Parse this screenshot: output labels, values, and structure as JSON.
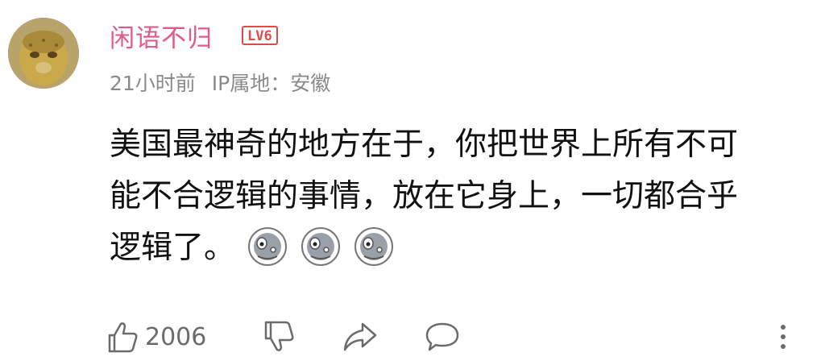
{
  "comment": {
    "username": "闲语不归",
    "level_badge": "LV6",
    "time": "21小时前",
    "ip_location": "IP属地：安徽",
    "text_lines": [
      "美国最神奇的地方在于，你把世界上所有不可",
      "能不合逻辑的事情，放在它身上，一切都合乎",
      "逻辑了。"
    ],
    "emojis": [
      "thinking-emoji",
      "thinking-emoji",
      "thinking-emoji"
    ]
  },
  "actions": {
    "like_count": "2006",
    "icons": [
      "thumbs-up-icon",
      "thumbs-down-icon",
      "share-icon",
      "comment-icon",
      "more-icon"
    ]
  },
  "colors": {
    "username": "#e05a8a",
    "badge": "#e24a4a",
    "meta": "#8a8a8a",
    "icon": "#6b6b6b"
  }
}
